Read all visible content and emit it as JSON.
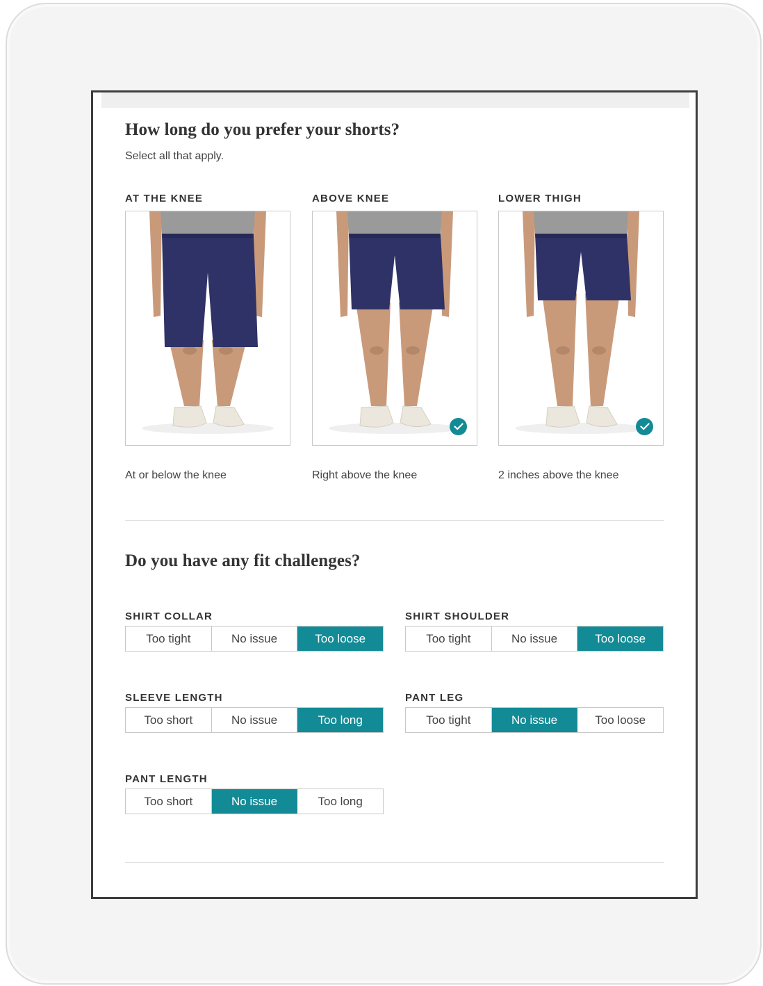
{
  "question_length": {
    "title": "How long do you prefer your shorts?",
    "subtitle": "Select all that apply.",
    "options": [
      {
        "label": "AT THE KNEE",
        "description": "At or below the knee",
        "selected": false,
        "hem_level": 0.58
      },
      {
        "label": "ABOVE KNEE",
        "description": "Right above the knee",
        "selected": true,
        "hem_level": 0.42
      },
      {
        "label": "LOWER THIGH",
        "description": "2 inches above the knee",
        "selected": true,
        "hem_level": 0.38
      }
    ]
  },
  "question_fit": {
    "title": "Do you have any fit challenges?",
    "groups": [
      {
        "key": "collar",
        "label": "SHIRT COLLAR",
        "options": [
          "Too tight",
          "No issue",
          "Too loose"
        ],
        "selected": 2
      },
      {
        "key": "shoulder",
        "label": "SHIRT SHOULDER",
        "options": [
          "Too tight",
          "No issue",
          "Too loose"
        ],
        "selected": 2
      },
      {
        "key": "sleeve",
        "label": "SLEEVE LENGTH",
        "options": [
          "Too short",
          "No issue",
          "Too long"
        ],
        "selected": 2
      },
      {
        "key": "pantleg",
        "label": "PANT LEG",
        "options": [
          "Too tight",
          "No issue",
          "Too loose"
        ],
        "selected": 1
      },
      {
        "key": "pantlen",
        "label": "PANT LENGTH",
        "options": [
          "Too short",
          "No issue",
          "Too long"
        ],
        "selected": 1
      }
    ]
  },
  "colors": {
    "accent": "#138b96",
    "shorts": "#2e3266",
    "shirt": "#9a9a9a",
    "skin": "#c99a7a",
    "shoe": "#ece7dc"
  },
  "icons": {
    "selected_check": "checkmark-icon"
  }
}
